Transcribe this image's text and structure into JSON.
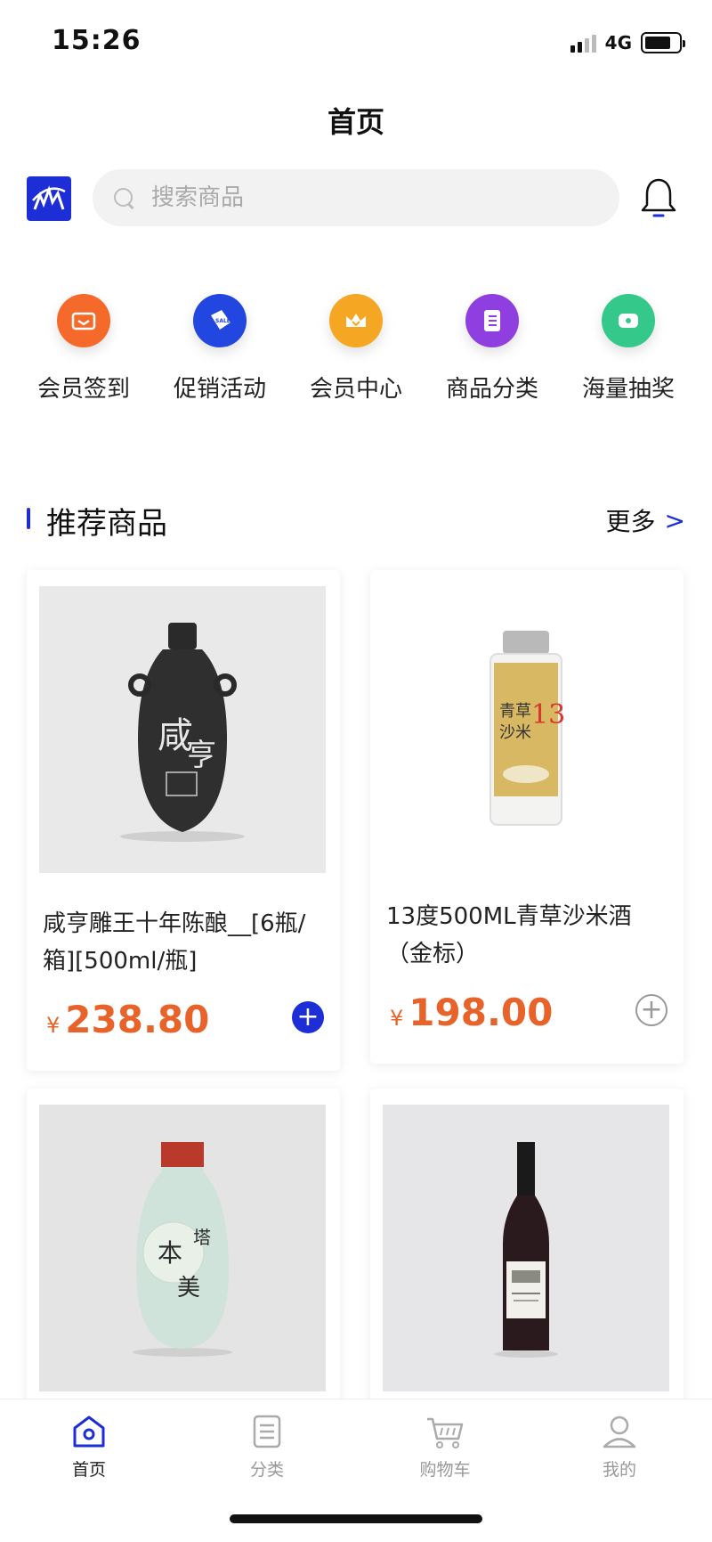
{
  "status_bar": {
    "time": "15:26",
    "network": "4G"
  },
  "header": {
    "title": "首页"
  },
  "search": {
    "placeholder": "搜索商品"
  },
  "quick_menu": [
    {
      "label": "会员签到",
      "icon": "sign-in-icon",
      "color": "#f56a2b"
    },
    {
      "label": "促销活动",
      "icon": "sale-tag-icon",
      "color": "#2147e0"
    },
    {
      "label": "会员中心",
      "icon": "crown-icon",
      "color": "#f5a623"
    },
    {
      "label": "商品分类",
      "icon": "list-icon",
      "color": "#8f3fe0"
    },
    {
      "label": "海量抽奖",
      "icon": "gift-icon",
      "color": "#34c98a"
    }
  ],
  "section": {
    "title": "推荐商品",
    "more_label": "更多",
    "more_arrow": ">"
  },
  "products": [
    {
      "name": "咸亨雕王十年陈酿__[6瓶/箱][500ml/瓶]",
      "currency": "¥",
      "price": "238.80",
      "add_style": "solid",
      "add_symbol": "+"
    },
    {
      "name": "13度500ML青草沙米酒（金标）",
      "currency": "¥",
      "price": "198.00",
      "add_style": "outline",
      "add_symbol": "+"
    },
    {
      "name": "",
      "currency": "",
      "price": ""
    },
    {
      "name": "",
      "currency": "",
      "price": ""
    }
  ],
  "tab_bar": [
    {
      "label": "首页",
      "icon": "home-icon",
      "active": true
    },
    {
      "label": "分类",
      "icon": "category-icon",
      "active": false
    },
    {
      "label": "购物车",
      "icon": "cart-icon",
      "active": false
    },
    {
      "label": "我的",
      "icon": "profile-icon",
      "active": false
    }
  ],
  "colors": {
    "accent": "#1d2ed6",
    "price": "#e8632a"
  }
}
